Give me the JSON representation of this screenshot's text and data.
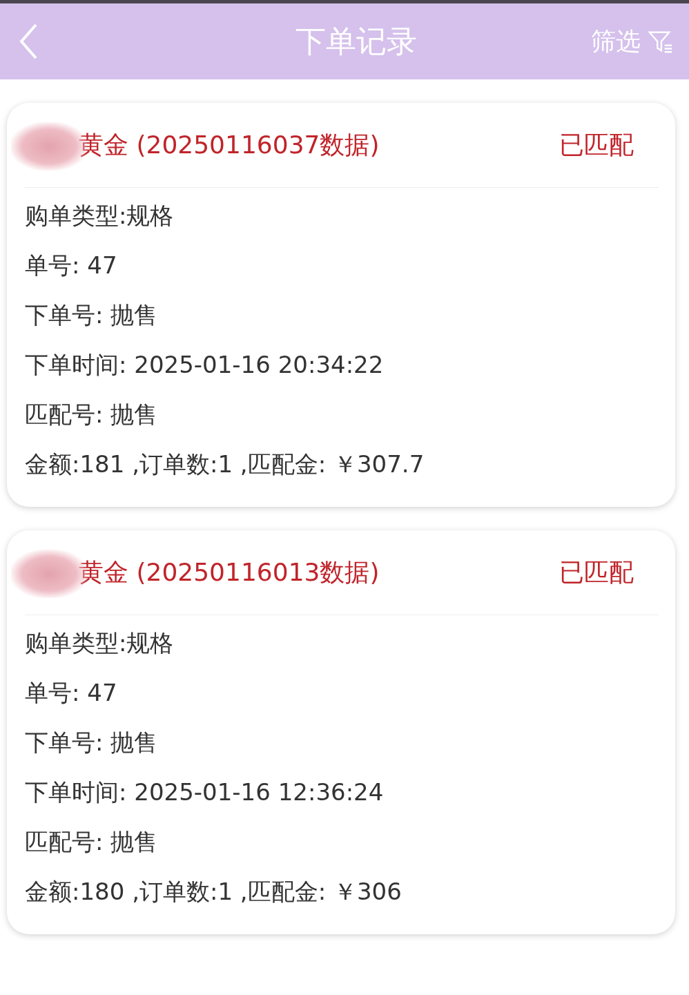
{
  "header": {
    "title": "下单记录",
    "filter": "筛选"
  },
  "orders": [
    {
      "title": "黄金 (20250116037数据)",
      "status": "已匹配",
      "lines": [
        "购单类型:规格",
        "单号: 47",
        "下单号: 抛售",
        "下单时间: 2025-01-16 20:34:22",
        "匹配号: 抛售",
        "金额:181 ,订单数:1 ,匹配金: ￥307.7"
      ]
    },
    {
      "title": "黄金 (20250116013数据)",
      "status": "已匹配",
      "lines": [
        "购单类型:规格",
        "单号: 47",
        "下单号: 抛售",
        "下单时间: 2025-01-16 12:36:24",
        "匹配号: 抛售",
        "金额:180 ,订单数:1 ,匹配金: ￥306"
      ]
    }
  ]
}
